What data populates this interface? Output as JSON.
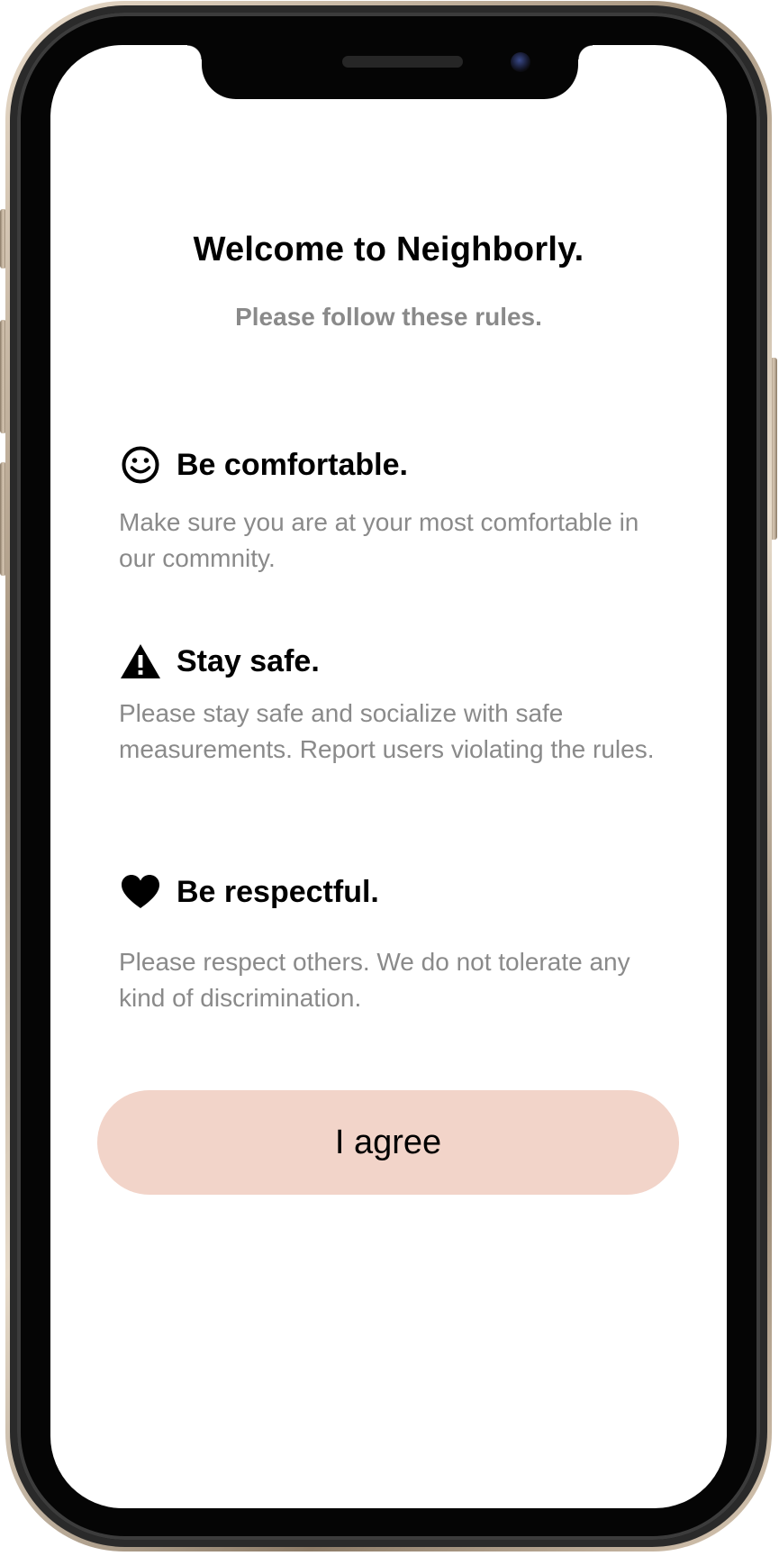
{
  "header": {
    "title": "Welcome to Neighborly.",
    "subtitle": "Please follow these rules."
  },
  "rules": [
    {
      "icon": "smiley-icon",
      "title": "Be comfortable.",
      "description": "Make sure you are at your most comfortable in our commnity."
    },
    {
      "icon": "warning-icon",
      "title": "Stay safe.",
      "description": "Please stay safe and socialize with safe measurements. Report users violating the rules."
    },
    {
      "icon": "heart-icon",
      "title": "Be respectful.",
      "description": "Please respect others. We do not tolerate any kind of discrimination."
    }
  ],
  "actions": {
    "agree_label": "I agree"
  },
  "colors": {
    "accent": "#f2d4c9",
    "title_text": "#000000",
    "muted_text": "#8a8a8a",
    "background": "#ffffff"
  }
}
